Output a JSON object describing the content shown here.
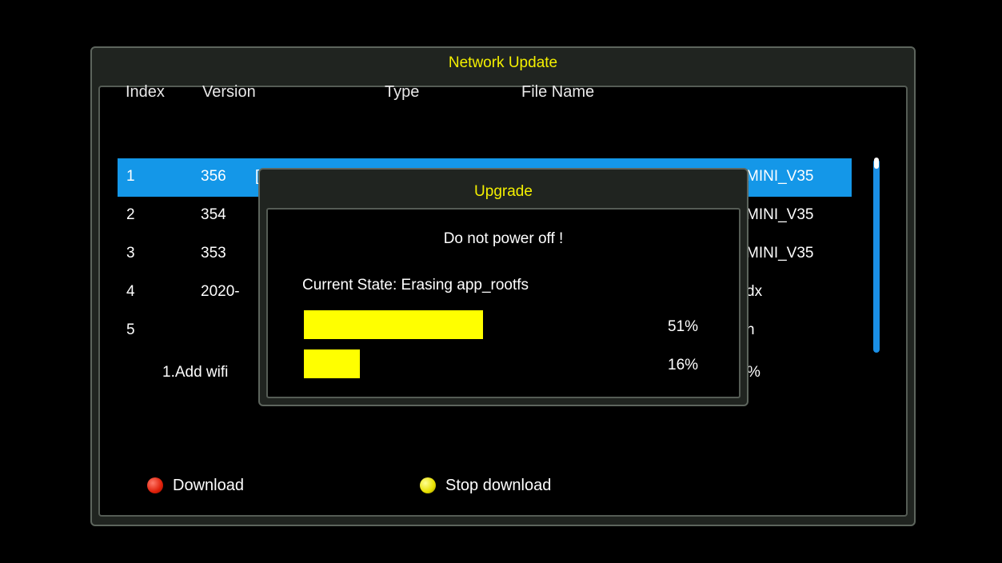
{
  "window": {
    "title": "Network Update"
  },
  "table": {
    "headers": {
      "index": "Index",
      "version": "Version",
      "type": "Type",
      "file_name": "File Name"
    },
    "rows": [
      {
        "index": "1",
        "version": "356",
        "version_tail": "[",
        "file_tail": "MINI_V35",
        "selected": true
      },
      {
        "index": "2",
        "version": "354",
        "file_tail": "MINI_V35"
      },
      {
        "index": "3",
        "version": "353",
        "file_tail": "MINI_V35"
      },
      {
        "index": "4",
        "version": "2020-",
        "file_tail": "dx"
      },
      {
        "index": "5",
        "version": "",
        "file_tail": "n"
      }
    ],
    "hint": "1.Add wifi",
    "hint_tail": "%"
  },
  "footer": {
    "download_label": "Download",
    "stop_label": "Stop download",
    "download_color": "#e0200a",
    "stop_color": "#e8e000"
  },
  "dialog": {
    "title": "Upgrade",
    "warning": "Do not power off !",
    "state": "Current State: Erasing app_rootfs",
    "progress": [
      {
        "percent_label": "51%",
        "fraction": 0.51
      },
      {
        "percent_label": "16%",
        "fraction": 0.16
      }
    ]
  },
  "colors": {
    "accent_yellow": "#f4f000",
    "selection_blue": "#1497e8",
    "progress_fill": "#ffff00"
  }
}
